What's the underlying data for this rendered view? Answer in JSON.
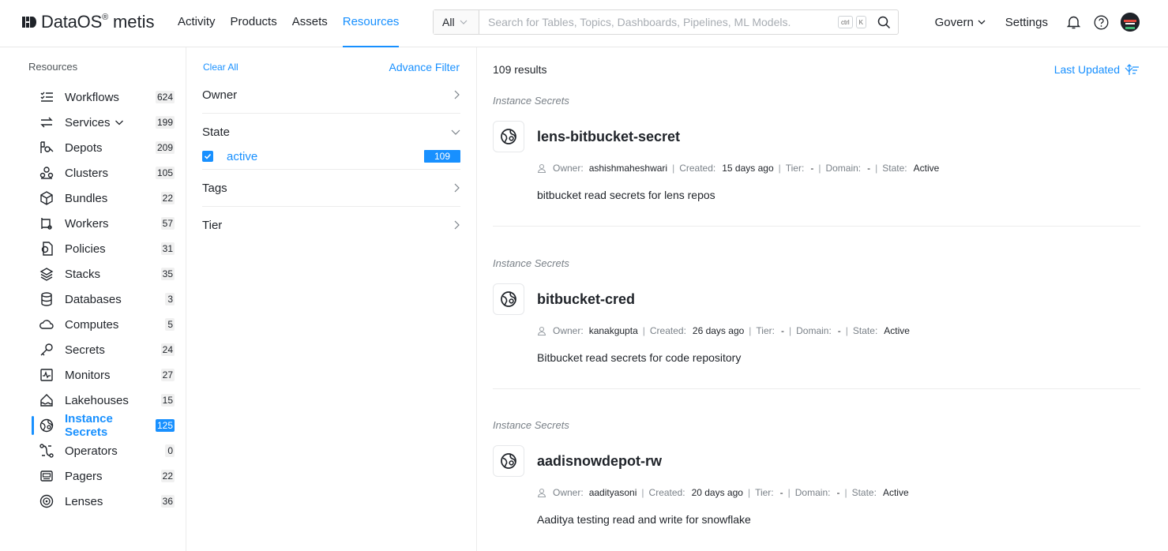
{
  "brand": {
    "name": "DataOS",
    "reg": "®",
    "product": "metis"
  },
  "nav": [
    {
      "label": "Activity"
    },
    {
      "label": "Products"
    },
    {
      "label": "Assets"
    },
    {
      "label": "Resources",
      "active": true
    }
  ],
  "search": {
    "scope": "All",
    "placeholder": "Search for Tables, Topics, Dashboards, Pipelines, ML Models.",
    "kbd1": "ctrl",
    "kbd2": "K"
  },
  "topright": {
    "govern": "Govern",
    "settings": "Settings"
  },
  "sidebar": {
    "title": "Resources",
    "items": [
      {
        "label": "Workflows",
        "count": "624",
        "icon": "workflows-icon"
      },
      {
        "label": "Services",
        "count": "199",
        "icon": "services-icon",
        "has_chevron": true
      },
      {
        "label": "Depots",
        "count": "209",
        "icon": "depots-icon"
      },
      {
        "label": "Clusters",
        "count": "105",
        "icon": "clusters-icon"
      },
      {
        "label": "Bundles",
        "count": "22",
        "icon": "bundles-icon"
      },
      {
        "label": "Workers",
        "count": "57",
        "icon": "workers-icon"
      },
      {
        "label": "Policies",
        "count": "31",
        "icon": "policies-icon"
      },
      {
        "label": "Stacks",
        "count": "35",
        "icon": "stacks-icon"
      },
      {
        "label": "Databases",
        "count": "3",
        "icon": "databases-icon"
      },
      {
        "label": "Computes",
        "count": "5",
        "icon": "computes-icon"
      },
      {
        "label": "Secrets",
        "count": "24",
        "icon": "secrets-icon"
      },
      {
        "label": "Monitors",
        "count": "27",
        "icon": "monitors-icon"
      },
      {
        "label": "Lakehouses",
        "count": "15",
        "icon": "lakehouses-icon"
      },
      {
        "label": "Instance Secrets",
        "count": "125",
        "icon": "instance-secrets-icon",
        "active": true
      },
      {
        "label": "Operators",
        "count": "0",
        "icon": "operators-icon"
      },
      {
        "label": "Pagers",
        "count": "22",
        "icon": "pagers-icon"
      },
      {
        "label": "Lenses",
        "count": "36",
        "icon": "lenses-icon"
      }
    ]
  },
  "filters": {
    "clear_all": "Clear All",
    "advance_filter": "Advance Filter",
    "owner": "Owner",
    "state": "State",
    "state_option": "active",
    "state_option_count": "109",
    "tags": "Tags",
    "tier": "Tier"
  },
  "results": {
    "count_text": "109 results",
    "sort_label": "Last Updated",
    "meta_labels": {
      "owner": "Owner:",
      "created": "Created:",
      "tier": "Tier:",
      "domain": "Domain:",
      "state": "State:"
    },
    "items": [
      {
        "type": "Instance Secrets",
        "title": "lens-bitbucket-secret",
        "owner": "ashishmaheshwari",
        "created": "15 days ago",
        "tier": "-",
        "domain": "-",
        "state": "Active",
        "description": "bitbucket read secrets for lens repos"
      },
      {
        "type": "Instance Secrets",
        "title": "bitbucket-cred",
        "owner": "kanakgupta",
        "created": "26 days ago",
        "tier": "-",
        "domain": "-",
        "state": "Active",
        "description": "Bitbucket read secrets for code repository"
      },
      {
        "type": "Instance Secrets",
        "title": "aadisnowdepot-rw",
        "owner": "aadityasoni",
        "created": "20 days ago",
        "tier": "-",
        "domain": "-",
        "state": "Active",
        "description": "Aaditya testing read and write for snowflake"
      }
    ]
  },
  "colors": {
    "accent": "#1890ff",
    "text": "#1f2329",
    "muted": "#7a8188"
  }
}
